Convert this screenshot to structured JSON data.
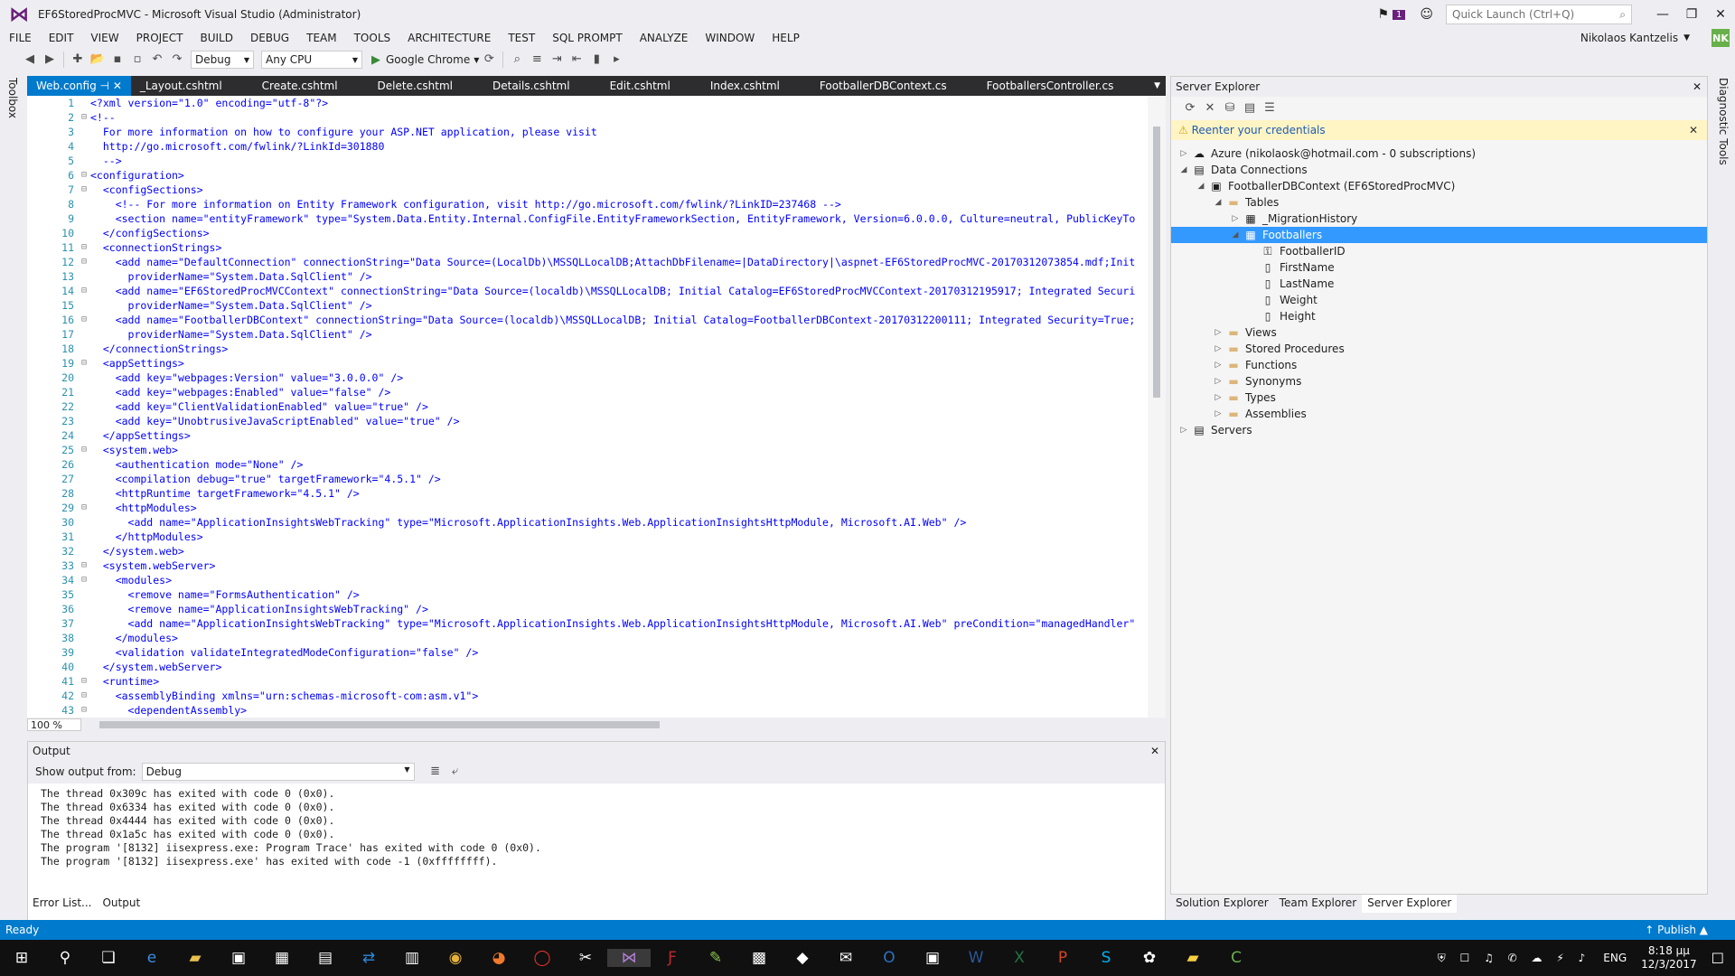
{
  "window": {
    "title": "EF6StoredProcMVC - Microsoft Visual Studio (Administrator)",
    "notif_count": "1",
    "quick_launch": "Quick Launch (Ctrl+Q)"
  },
  "menu": [
    "FILE",
    "EDIT",
    "VIEW",
    "PROJECT",
    "BUILD",
    "DEBUG",
    "TEAM",
    "TOOLS",
    "ARCHITECTURE",
    "TEST",
    "SQL PROMPT",
    "ANALYZE",
    "WINDOW",
    "HELP"
  ],
  "user": {
    "name": "Nikolaos Kantzelis",
    "initials": "NK"
  },
  "toolbar": {
    "config": "Debug",
    "platform": "Any CPU",
    "browser": "Google Chrome"
  },
  "side": {
    "left": "Toolbox",
    "right": "Diagnostic Tools"
  },
  "tabs": [
    "Web.config",
    "_Layout.cshtml",
    "Create.cshtml",
    "Delete.cshtml",
    "Details.cshtml",
    "Edit.cshtml",
    "Index.cshtml",
    "FootballerDBContext.cs",
    "FootballersController.cs"
  ],
  "code": [
    "<?xml version=\"1.0\" encoding=\"utf-8\"?>",
    "<!--",
    "  For more information on how to configure your ASP.NET application, please visit",
    "  http://go.microsoft.com/fwlink/?LinkId=301880",
    "  -->",
    "<configuration>",
    "  <configSections>",
    "    <!-- For more information on Entity Framework configuration, visit http://go.microsoft.com/fwlink/?LinkID=237468 -->",
    "    <section name=\"entityFramework\" type=\"System.Data.Entity.Internal.ConfigFile.EntityFrameworkSection, EntityFramework, Version=6.0.0.0, Culture=neutral, PublicKeyTo",
    "  </configSections>",
    "  <connectionStrings>",
    "    <add name=\"DefaultConnection\" connectionString=\"Data Source=(LocalDb)\\MSSQLLocalDB;AttachDbFilename=|DataDirectory|\\aspnet-EF6StoredProcMVC-20170312073854.mdf;Init",
    "      providerName=\"System.Data.SqlClient\" />",
    "    <add name=\"EF6StoredProcMVCContext\" connectionString=\"Data Source=(localdb)\\MSSQLLocalDB; Initial Catalog=EF6StoredProcMVCContext-20170312195917; Integrated Securi",
    "      providerName=\"System.Data.SqlClient\" />",
    "    <add name=\"FootballerDBContext\" connectionString=\"Data Source=(localdb)\\MSSQLLocalDB; Initial Catalog=FootballerDBContext-20170312200111; Integrated Security=True;",
    "      providerName=\"System.Data.SqlClient\" />",
    "  </connectionStrings>",
    "  <appSettings>",
    "    <add key=\"webpages:Version\" value=\"3.0.0.0\" />",
    "    <add key=\"webpages:Enabled\" value=\"false\" />",
    "    <add key=\"ClientValidationEnabled\" value=\"true\" />",
    "    <add key=\"UnobtrusiveJavaScriptEnabled\" value=\"true\" />",
    "  </appSettings>",
    "  <system.web>",
    "    <authentication mode=\"None\" />",
    "    <compilation debug=\"true\" targetFramework=\"4.5.1\" />",
    "    <httpRuntime targetFramework=\"4.5.1\" />",
    "    <httpModules>",
    "      <add name=\"ApplicationInsightsWebTracking\" type=\"Microsoft.ApplicationInsights.Web.ApplicationInsightsHttpModule, Microsoft.AI.Web\" />",
    "    </httpModules>",
    "  </system.web>",
    "  <system.webServer>",
    "    <modules>",
    "      <remove name=\"FormsAuthentication\" />",
    "      <remove name=\"ApplicationInsightsWebTracking\" />",
    "      <add name=\"ApplicationInsightsWebTracking\" type=\"Microsoft.ApplicationInsights.Web.ApplicationInsightsHttpModule, Microsoft.AI.Web\" preCondition=\"managedHandler\"",
    "    </modules>",
    "    <validation validateIntegratedModeConfiguration=\"false\" />",
    "  </system.webServer>",
    "  <runtime>",
    "    <assemblyBinding xmlns=\"urn:schemas-microsoft-com:asm.v1\">",
    "      <dependentAssembly>"
  ],
  "zoom": "100 %",
  "output": {
    "title": "Output",
    "show_from": "Show output from:",
    "source": "Debug",
    "lines": [
      "The thread 0x309c has exited with code 0 (0x0).",
      "The thread 0x6334 has exited with code 0 (0x0).",
      "The thread 0x4444 has exited with code 0 (0x0).",
      "The thread 0x1a5c has exited with code 0 (0x0).",
      "The program '[8132] iisexpress.exe: Program Trace' has exited with code 0 (0x0).",
      "The program '[8132] iisexpress.exe' has exited with code -1 (0xffffffff)."
    ]
  },
  "bottom_tabs": [
    "Error List...",
    "Output"
  ],
  "server_explorer": {
    "title": "Server Explorer",
    "banner": "Reenter your credentials",
    "tree": [
      {
        "label": "Azure (nikolaosk@hotmail.com - 0 subscriptions)",
        "icon": "☁"
      },
      {
        "label": "Data Connections",
        "icon": "▤"
      },
      {
        "label": "FootballerDBContext (EF6StoredProcMVC)",
        "icon": "▣"
      },
      {
        "label": "Tables",
        "icon": "▬"
      },
      {
        "label": "_MigrationHistory",
        "icon": "▦"
      },
      {
        "label": "Footballers",
        "icon": "▦"
      },
      {
        "label": "FootballerID",
        "icon": "⚿"
      },
      {
        "label": "FirstName",
        "icon": "▯"
      },
      {
        "label": "LastName",
        "icon": "▯"
      },
      {
        "label": "Weight",
        "icon": "▯"
      },
      {
        "label": "Height",
        "icon": "▯"
      },
      {
        "label": "Views",
        "icon": "▬"
      },
      {
        "label": "Stored Procedures",
        "icon": "▬"
      },
      {
        "label": "Functions",
        "icon": "▬"
      },
      {
        "label": "Synonyms",
        "icon": "▬"
      },
      {
        "label": "Types",
        "icon": "▬"
      },
      {
        "label": "Assemblies",
        "icon": "▬"
      },
      {
        "label": "Servers",
        "icon": "▤"
      }
    ]
  },
  "right_tabs": [
    "Solution Explorer",
    "Team Explorer",
    "Server Explorer"
  ],
  "status": {
    "left": "Ready",
    "right": "Publish"
  },
  "tray": {
    "lang": "ENG",
    "time": "8:18 μμ",
    "date": "12/3/2017"
  }
}
